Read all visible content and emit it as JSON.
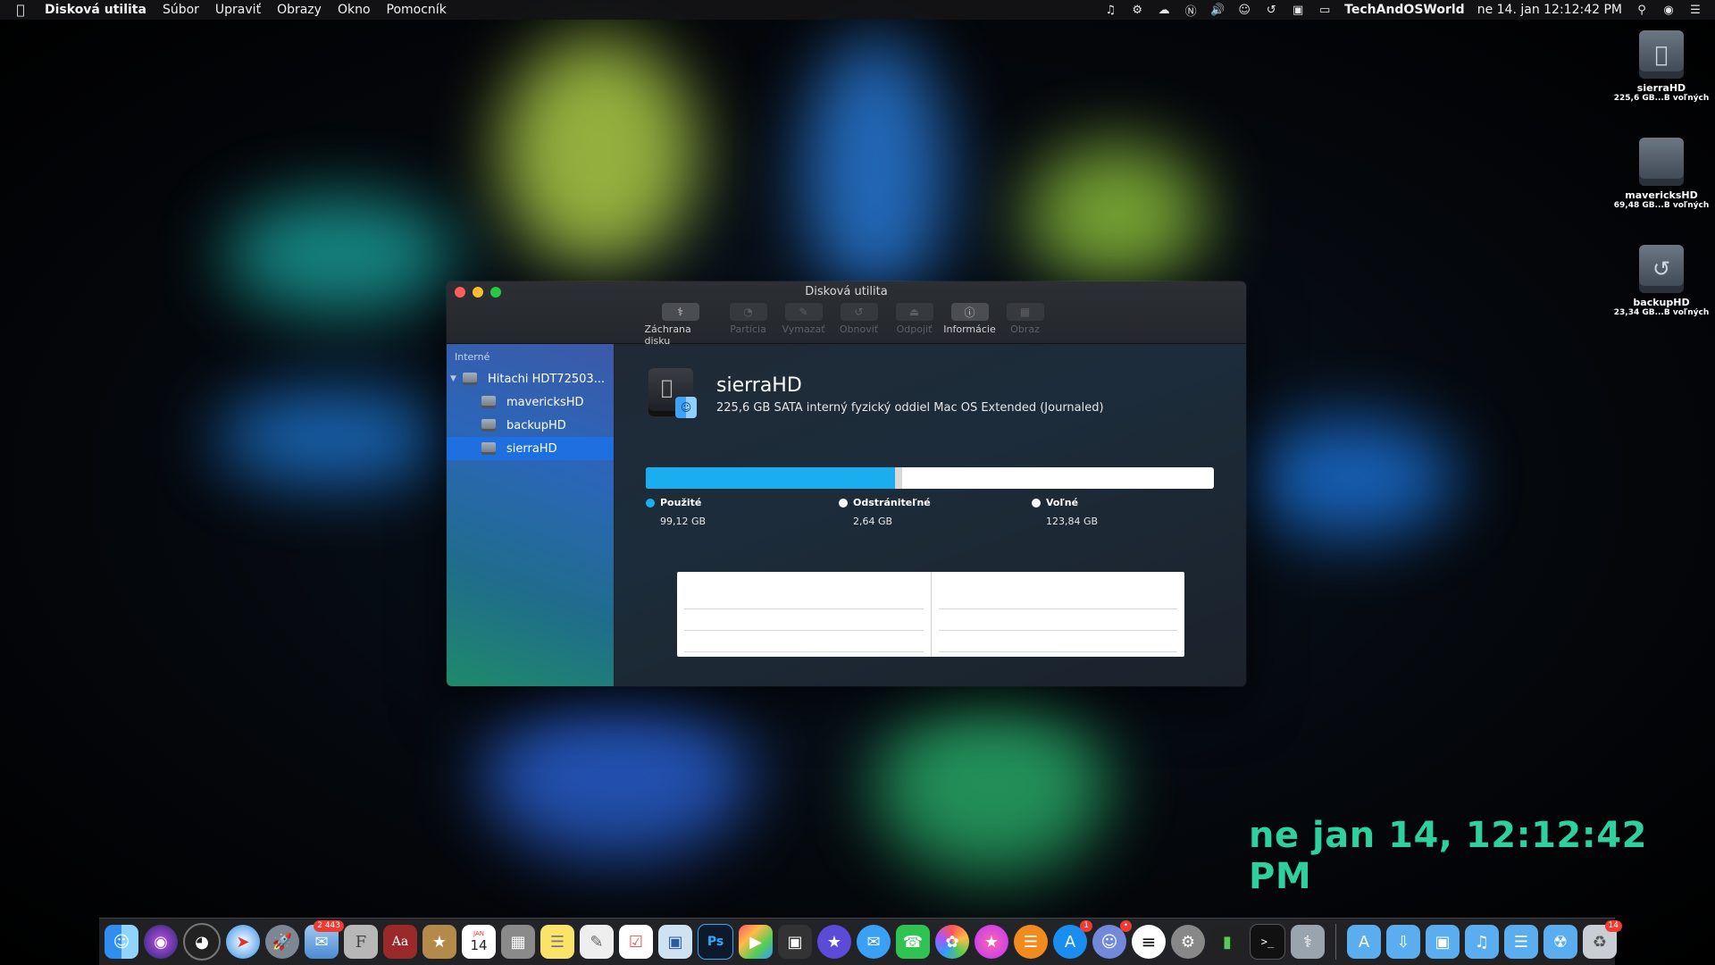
{
  "menubar": {
    "app_name": "Disková utilita",
    "menus": [
      "Súbor",
      "Upraviť",
      "Obrazy",
      "Okno",
      "Pomocník"
    ],
    "user": "TechAndOSWorld",
    "clock": "ne 14. jan  12:12:42 PM"
  },
  "desktop": {
    "volumes": [
      {
        "name": "sierraHD",
        "sub": "225,6 GB...B voľných"
      },
      {
        "name": "mavericksHD",
        "sub": "69,48 GB...B voľných"
      },
      {
        "name": "backupHD",
        "sub": "23,34 GB...B voľných"
      }
    ],
    "big_clock": "ne jan 14, 12:12:42 PM"
  },
  "window": {
    "title": "Disková utilita",
    "toolbar": [
      {
        "label": "Záchrana disku",
        "enabled": true
      },
      {
        "label": "Partícia",
        "enabled": false
      },
      {
        "label": "Vymazať",
        "enabled": false
      },
      {
        "label": "Obnoviť",
        "enabled": false
      },
      {
        "label": "Odpojiť",
        "enabled": false
      },
      {
        "label": "Informácie",
        "enabled": true
      },
      {
        "label": "Obraz",
        "enabled": false
      }
    ],
    "sidebar": {
      "section": "Interné",
      "disk": "Hitachi HDT72503...",
      "volumes": [
        "mavericksHD",
        "backupHD",
        "sierraHD"
      ],
      "selected": "sierraHD"
    },
    "volume": {
      "name": "sierraHD",
      "description": "225,6 GB SATA interný fyzický oddiel Mac OS Extended (Journaled)"
    },
    "usage": {
      "used": {
        "label": "Použité",
        "value": "99,12 GB",
        "gb": 99.12,
        "color": "#1aaef0"
      },
      "purgeable": {
        "label": "Odstrániteľné",
        "value": "2,64 GB",
        "gb": 2.64,
        "color": "#ffffff"
      },
      "free": {
        "label": "Voľné",
        "value": "123,84 GB",
        "gb": 123.84,
        "color": "#ffffff"
      }
    }
  },
  "dock": {
    "badges": {
      "mail": "2 443",
      "app_store": "1",
      "discord": "•",
      "trash": "14"
    },
    "calendar_day": "14",
    "calendar_month": "JAN"
  },
  "colors": {
    "accent": "#1e6fe0",
    "used": "#1aaef0",
    "clock": "#2fd0a0"
  }
}
